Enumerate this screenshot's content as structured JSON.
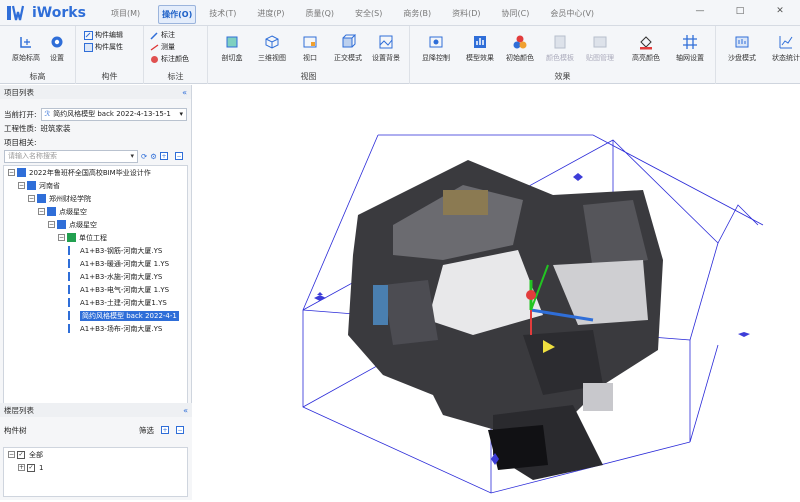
{
  "app": {
    "name": "iWorks"
  },
  "menu": [
    "项目(M)",
    "操作(O)",
    "技术(T)",
    "进度(P)",
    "质量(Q)",
    "安全(S)",
    "商务(B)",
    "资料(D)",
    "协同(C)",
    "会员中心(V)"
  ],
  "window_controls": [
    "—",
    "□",
    "✕"
  ],
  "ribbon": {
    "groups": {
      "biaogao": "标高",
      "goujian": "构件",
      "biaozhu": "标注",
      "shitu": "视图",
      "xiaoguo": "效果"
    },
    "buttons": {
      "yuanshi": "原始标高",
      "shezhi": "设置",
      "goujian_bianji": "构件编辑",
      "goujian_shuxing": "构件属性",
      "biaozhu": "标注",
      "celiang": "测量",
      "biaozhu_yanse": "标注颜色",
      "qiegekuai": "剖切盒",
      "sanwei": "三维视图",
      "shikou": "视口",
      "zhengjiao": "正交模式",
      "beijing": "设置背景",
      "dengjiang": "显降控制",
      "moxing_xiaoguo": "模型效果",
      "chushi_yanse": "初始颜色",
      "yanse_muban": "颜色模板",
      "tietu_guanli": "贴图管理",
      "gaoliang": "高亮颜色",
      "zhouwang": "轴网设置",
      "shapan": "沙盘模式",
      "zhuangtai": "状态统计"
    }
  },
  "project_panel": {
    "title": "项目列表",
    "current_label": "当前打开:",
    "current_value": "简约风格模型 back 2022-4-13-15-1",
    "property_label": "工程性质:",
    "property_value": "班筑家装",
    "related_label": "项目相关:",
    "search_placeholder": "请输入名称搜索",
    "tree": [
      {
        "label": "2022年鲁班杯全国高校BIM毕业设计作",
        "level": 0,
        "expand": "−"
      },
      {
        "label": "河南省",
        "level": 1,
        "expand": "−"
      },
      {
        "label": "郑州财经学院",
        "level": 2,
        "expand": "−"
      },
      {
        "label": "点缀星空",
        "level": 3,
        "expand": "−"
      },
      {
        "label": "点缀星空",
        "level": 4,
        "expand": "−"
      },
      {
        "label": "单位工程",
        "level": 5,
        "expand": "−"
      },
      {
        "label": "A1+B3-钢筋-河南大厦.YS",
        "level": 6
      },
      {
        "label": "A1+B3-暖通-河南大厦 1.YS",
        "level": 6
      },
      {
        "label": "A1+B3-水施-河南大厦.YS",
        "level": 6
      },
      {
        "label": "A1+B3-电气-河南大厦 1.YS",
        "level": 6
      },
      {
        "label": "A1+B3-土建-河南大厦1.YS",
        "level": 6
      },
      {
        "label": "简约风格模型 back 2022-4-1",
        "level": 6,
        "selected": true
      },
      {
        "label": "A1+B3-场布-河南大厦.YS",
        "level": 6
      }
    ]
  },
  "floor_panel": {
    "title": "楼层列表",
    "tree_label": "构件树",
    "filter_label": "筛选",
    "items": [
      {
        "label": "全部",
        "level": 0,
        "expand": "−"
      },
      {
        "label": "1",
        "level": 1,
        "expand": "+"
      }
    ]
  },
  "colors": {
    "accent": "#2f6ed8",
    "bbox": "#2a2ad8"
  }
}
